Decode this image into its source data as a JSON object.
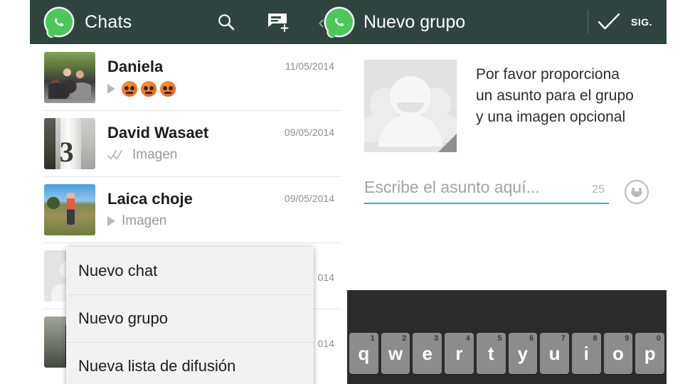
{
  "header": {
    "left": {
      "logo_icon": "whatsapp-logo-icon",
      "title": "Chats",
      "search_icon": "search-icon",
      "new_chat_icon": "new-message-icon"
    },
    "right": {
      "back_chevron": "‹",
      "logo_icon": "whatsapp-logo-icon",
      "title": "Nuevo grupo",
      "check_icon": "check-icon",
      "next_label": "SIG."
    }
  },
  "chat_list": [
    {
      "name": "Daniela",
      "date": "11/05/2014",
      "preview_type": "emoji",
      "preview": "",
      "status_icon": "play-triangle-icon",
      "emoji_count": 3,
      "avatar": "family-photo"
    },
    {
      "name": "David Wasaet",
      "date": "09/05/2014",
      "preview_type": "text",
      "preview": "Imagen",
      "status_icon": "double-check-icon",
      "avatar": "post-number-3-photo"
    },
    {
      "name": "Laica choje",
      "date": "09/05/2014",
      "preview_type": "text",
      "preview": "Imagen",
      "status_icon": "play-triangle-icon",
      "avatar": "field-man-photo"
    },
    {
      "name": "",
      "date": "014",
      "preview_type": "text",
      "preview": "",
      "status_icon": "",
      "avatar": "gray-placeholder"
    },
    {
      "name": "",
      "date": "014",
      "preview_type": "text",
      "preview": "",
      "status_icon": "",
      "avatar": "soldier-photo"
    }
  ],
  "menu": {
    "items": [
      {
        "label": "Nuevo chat"
      },
      {
        "label": "Nuevo grupo"
      },
      {
        "label": "Nueva lista de difusión"
      }
    ]
  },
  "group_setup": {
    "avatar_icon": "group-avatar-placeholder-icon",
    "prompt_lines": [
      "Por favor proporciona",
      "un asunto para el grupo",
      "y una imagen opcional"
    ],
    "subject_placeholder": "Escribe el asunto aquí...",
    "subject_value": "",
    "char_count": "25",
    "emoji_icon": "emoji-smiley-icon"
  },
  "keyboard": {
    "row1": [
      {
        "letter": "q",
        "num": "1"
      },
      {
        "letter": "w",
        "num": "2"
      },
      {
        "letter": "e",
        "num": "3"
      },
      {
        "letter": "r",
        "num": "4"
      },
      {
        "letter": "t",
        "num": "5"
      },
      {
        "letter": "y",
        "num": "6"
      },
      {
        "letter": "u",
        "num": "7"
      },
      {
        "letter": "i",
        "num": "8"
      },
      {
        "letter": "o",
        "num": "9"
      },
      {
        "letter": "p",
        "num": "0"
      }
    ]
  },
  "colors": {
    "header_bg": "#30443f",
    "brand_green": "#4bc85a",
    "underline_blue": "#3ea6dd",
    "menu_bg": "#f2f2f2",
    "keyboard_bg": "#2b2b2b",
    "key_bg": "#8c8c8c"
  }
}
